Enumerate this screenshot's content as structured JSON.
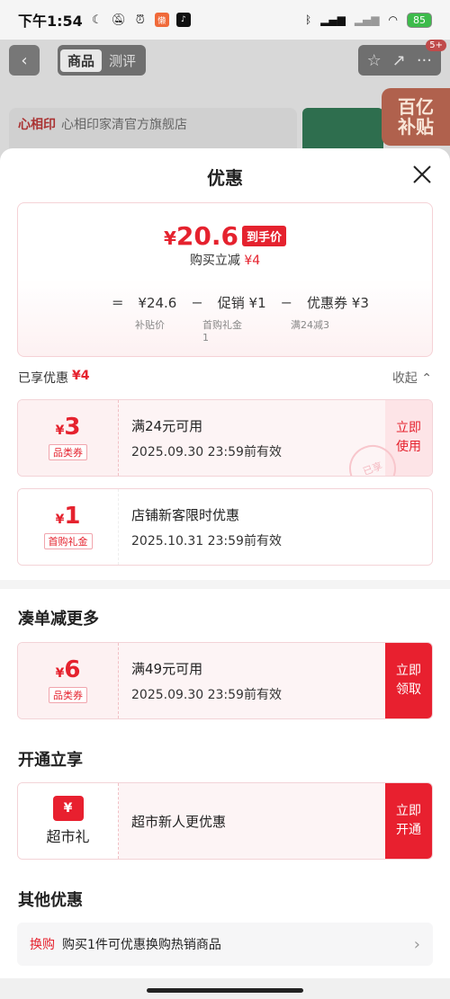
{
  "status_bar": {
    "time": "下午1:54",
    "battery": "85",
    "badge_count": "5+"
  },
  "background_page": {
    "tabs": [
      "商品",
      "测评"
    ],
    "store_name": "心相印家清官方旗舰店",
    "store_logo": "心相印",
    "promo_line1": "百亿",
    "promo_line2": "补贴"
  },
  "sheet": {
    "title": "优惠",
    "price": {
      "currency": "¥",
      "amount": "20.6",
      "tag": "到手价",
      "reduce_label": "购买立减",
      "reduce_amount": "¥4"
    },
    "calc": {
      "eq": "=",
      "subsidy_value": "¥24.6",
      "subsidy_label": "补贴价",
      "minus1": "−",
      "promo_value": "促销 ¥1",
      "promo_label_line1": "首购礼金",
      "promo_label_line2": "1",
      "minus2": "−",
      "coupon_value": "优惠券 ¥3",
      "coupon_label": "满24减3"
    },
    "applied": {
      "label": "已享优惠",
      "amount": "¥4",
      "collapse": "收起"
    },
    "coupons_applied": [
      {
        "amount": "3",
        "type": "品类券",
        "cond": "满24元可用",
        "expire": "2025.09.30 23:59前有效",
        "btn_line1": "立即",
        "btn_line2": "使用",
        "stamp": "已享"
      },
      {
        "amount": "1",
        "type": "首购礼金",
        "cond": "店铺新客限时优惠",
        "expire": "2025.10.31 23:59前有效"
      }
    ],
    "more_section": {
      "title": "凑单减更多",
      "coupon": {
        "amount": "6",
        "type": "品类券",
        "cond": "满49元可用",
        "expire": "2025.09.30 23:59前有效",
        "btn_line1": "立即",
        "btn_line2": "领取"
      }
    },
    "open_section": {
      "title": "开通立享",
      "icon_text": "¥",
      "label": "超市礼",
      "desc": "超市新人更优惠",
      "btn_line1": "立即",
      "btn_line2": "开通"
    },
    "other_section": {
      "title": "其他优惠",
      "item_tag": "换购",
      "item_text": "购买1件可优惠换购热销商品"
    }
  },
  "colors": {
    "accent": "#e5222e",
    "accent_light": "#fdf1f2"
  }
}
